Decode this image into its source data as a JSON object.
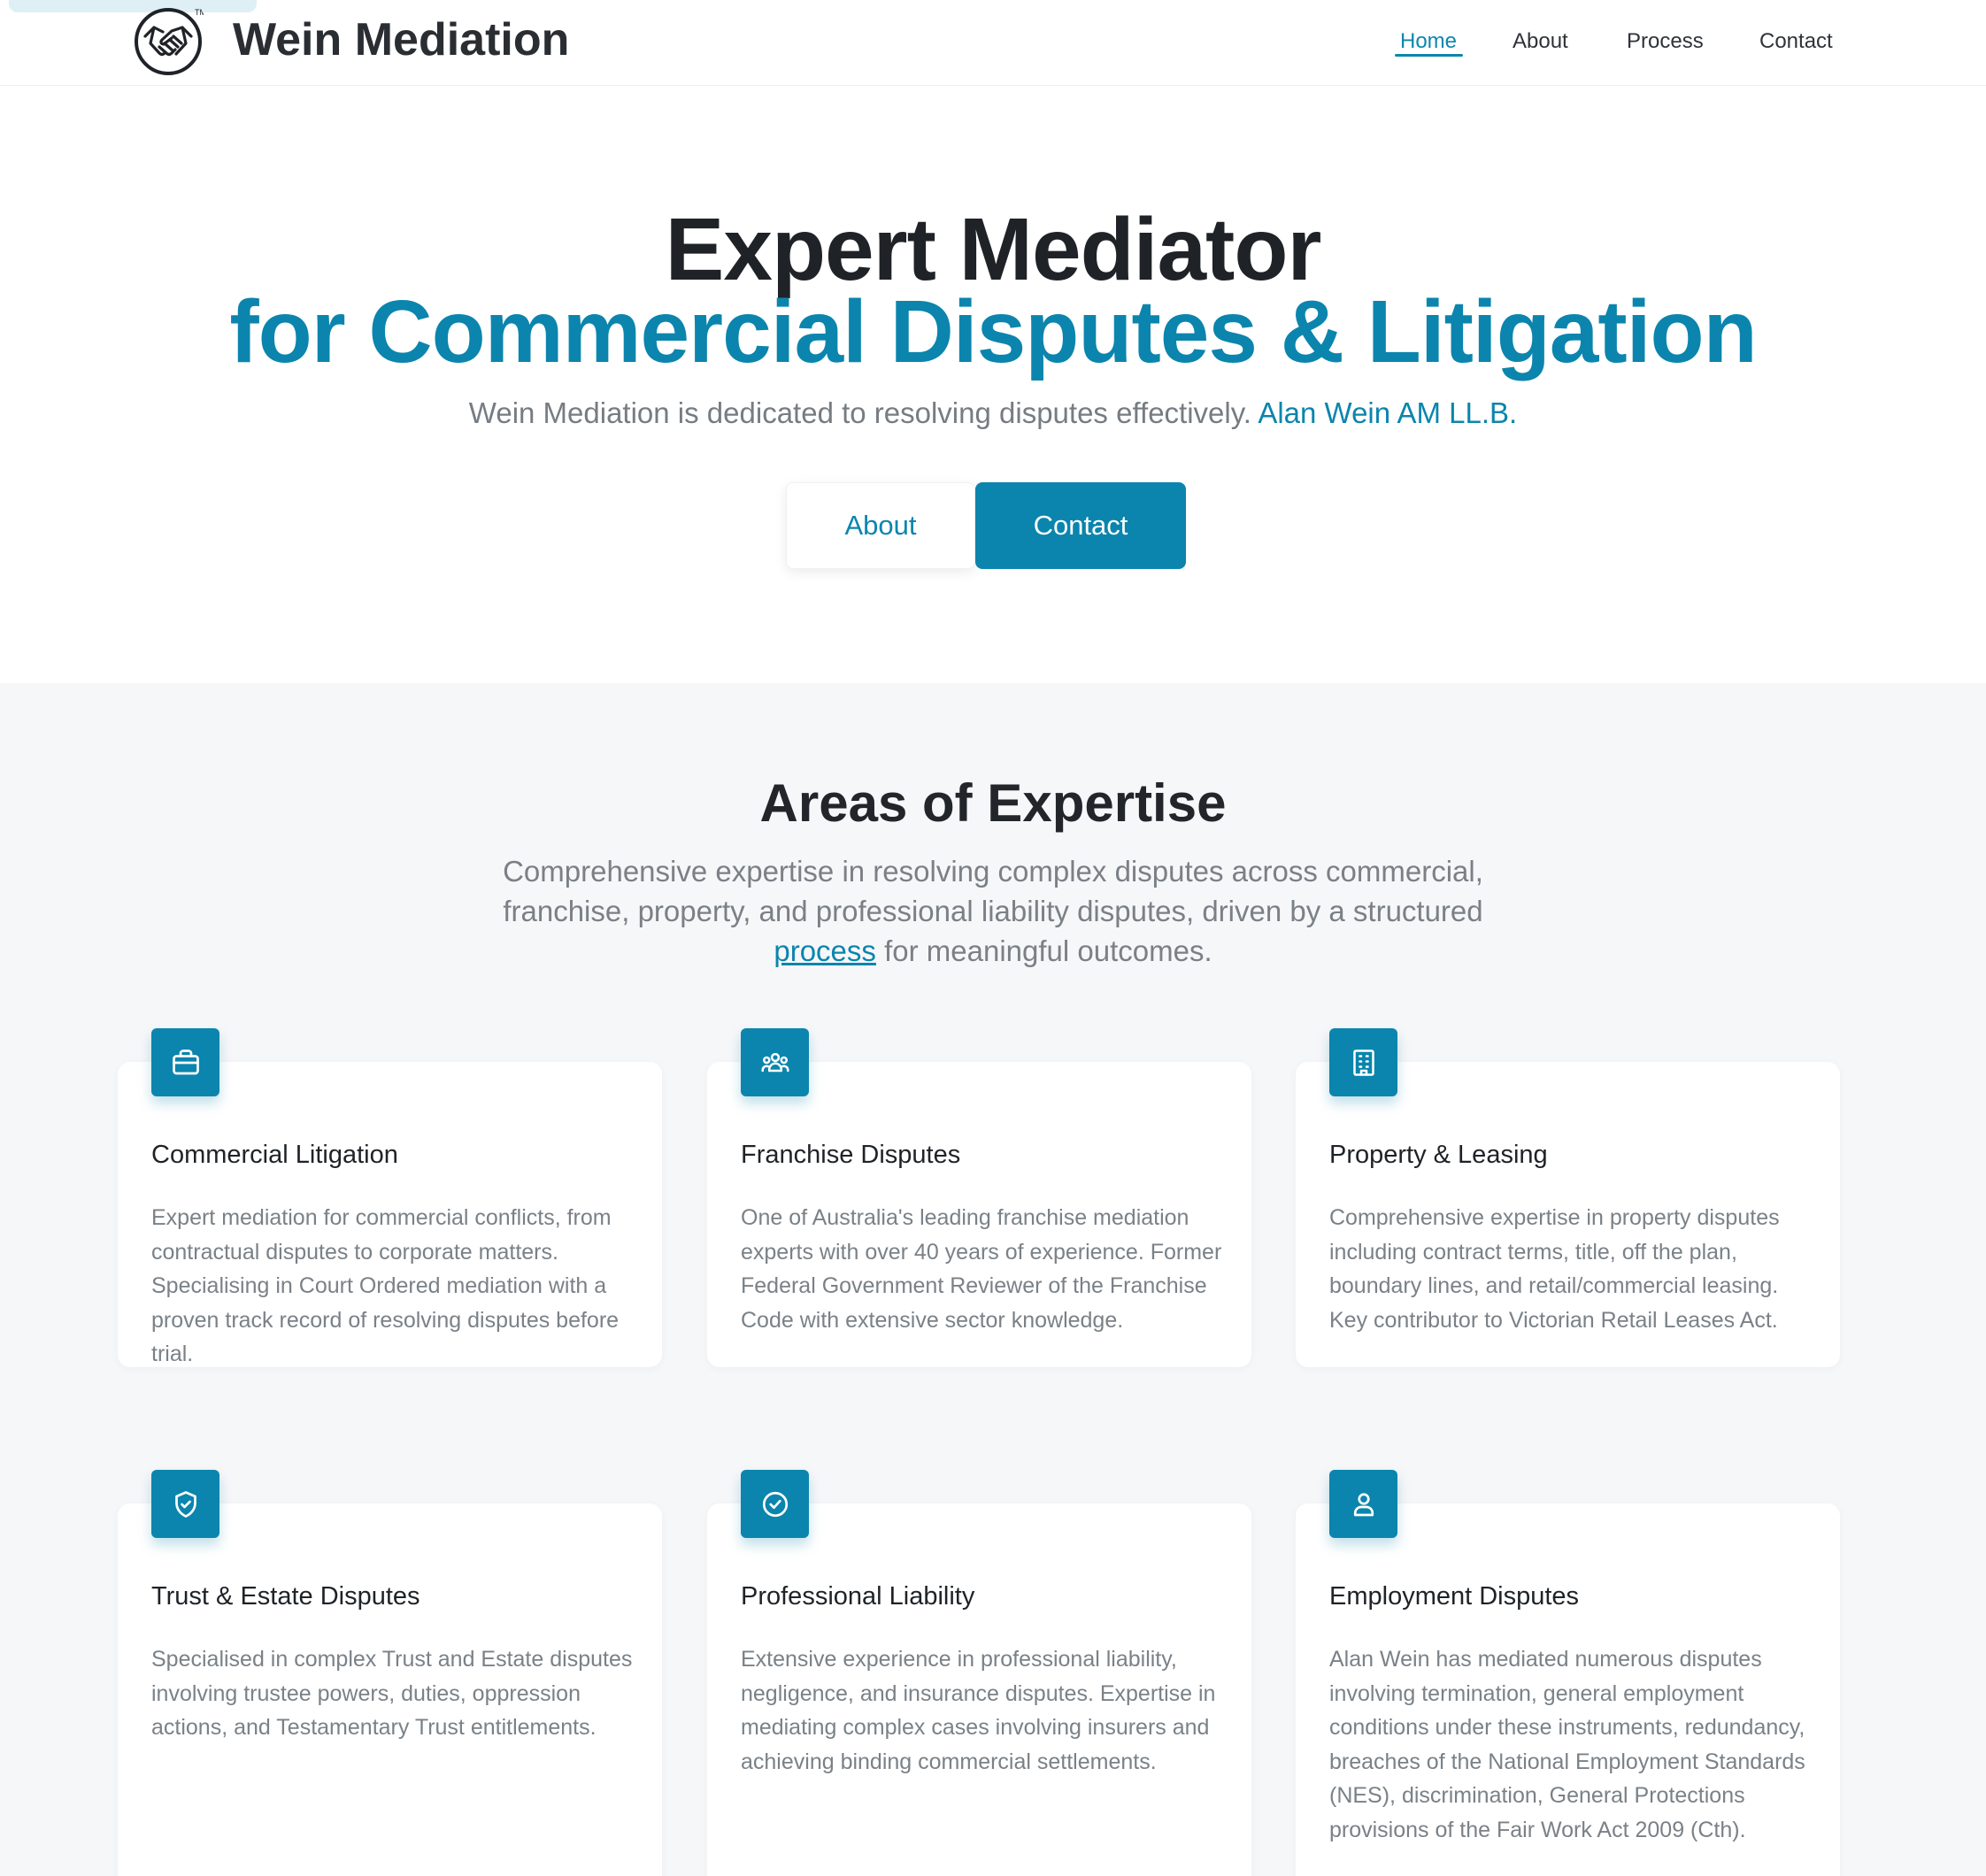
{
  "header": {
    "brand": "Wein Mediation",
    "logo_icon": "handshake-icon",
    "nav": [
      {
        "label": "Home",
        "active": true
      },
      {
        "label": "About",
        "active": false
      },
      {
        "label": "Process",
        "active": false
      },
      {
        "label": "Contact",
        "active": false
      }
    ]
  },
  "hero": {
    "title_line1": "Expert Mediator",
    "title_line2": "for Commercial Disputes & Litigation",
    "subtitle": "Wein Mediation is dedicated to resolving disputes effectively.",
    "subtitle_accent": "Alan Wein AM LL.B.",
    "about_button": "About",
    "contact_button": "Contact"
  },
  "expertise": {
    "title": "Areas of Expertise",
    "desc_before": "Comprehensive expertise in resolving complex disputes across commercial, franchise, property, and professional liability disputes, driven by a structured ",
    "desc_link": "process",
    "desc_after": " for meaningful outcomes.",
    "cards": [
      {
        "icon": "briefcase-icon",
        "title": "Commercial Litigation",
        "text": "Expert mediation for commercial conflicts, from contractual disputes to corporate matters. Specialising in Court Ordered mediation with a proven track record of resolving disputes before trial."
      },
      {
        "icon": "users-icon",
        "title": "Franchise Disputes",
        "text": "One of Australia's leading franchise mediation experts with over 40 years of experience. Former Federal Government Reviewer of the Franchise Code with extensive sector knowledge."
      },
      {
        "icon": "building-icon",
        "title": "Property & Leasing",
        "text": "Comprehensive expertise in property disputes including contract terms, title, off the plan, boundary lines, and retail/commercial leasing. Key contributor to Victorian Retail Leases Act."
      },
      {
        "icon": "shield-check-icon",
        "title": "Trust & Estate Disputes",
        "text": "Specialised in complex Trust and Estate disputes involving trustee powers, duties, oppression actions, and Testamentary Trust entitlements."
      },
      {
        "icon": "check-circle-icon",
        "title": "Professional Liability",
        "text": "Extensive experience in professional liability, negligence, and insurance disputes. Expertise in mediating complex cases involving insurers and achieving binding commercial settlements."
      },
      {
        "icon": "user-icon",
        "title": "Employment Disputes",
        "text": "Alan Wein has mediated numerous disputes involving termination, general employment conditions under these instruments, redundancy, breaches of the National Employment Standards (NES), discrimination, General Protections provisions of the Fair Work Act 2009 (Cth)."
      }
    ]
  },
  "colors": {
    "accent": "#0b85ad",
    "text_dark": "#1f2327",
    "text_muted": "#7a8187",
    "section_bg": "#f6f7f9"
  }
}
